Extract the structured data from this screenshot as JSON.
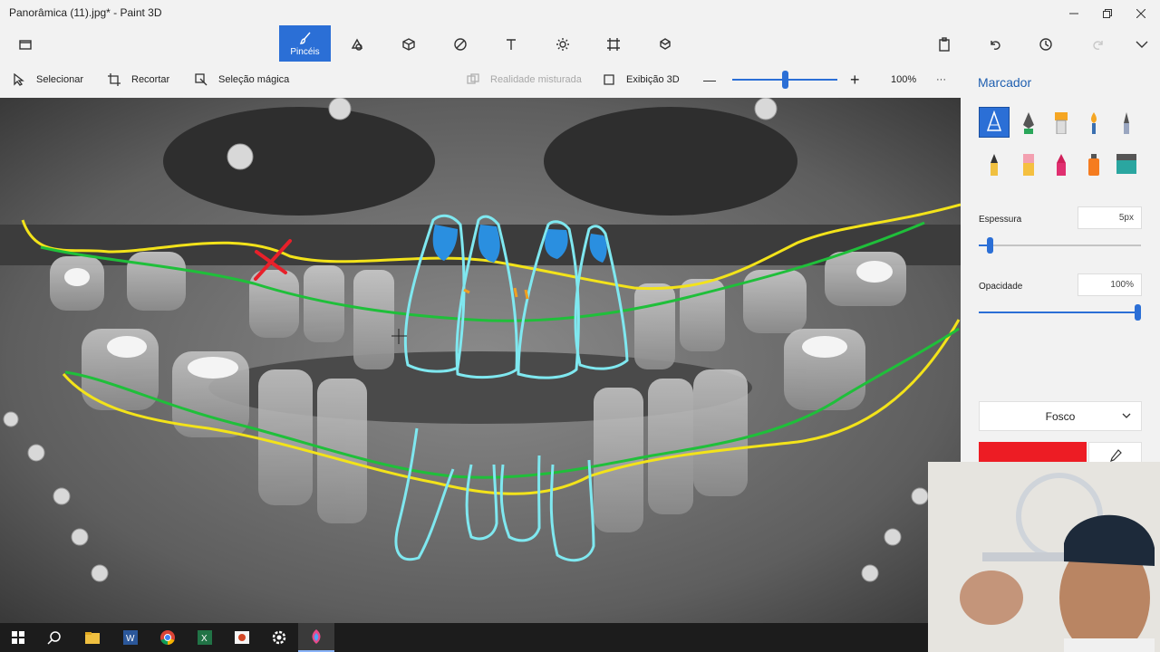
{
  "window": {
    "title": "Panorâmica (11).jpg* - Paint 3D",
    "controls": [
      "minimize",
      "maximize",
      "close"
    ]
  },
  "top_toolbar": {
    "tabs": [
      {
        "name": "menu",
        "icon": "folder-icon"
      },
      {
        "name": "brushes",
        "icon": "brush-icon",
        "label": "Pincéis",
        "active": true
      },
      {
        "name": "2d-shapes",
        "icon": "shapes-2d-icon"
      },
      {
        "name": "3d-shapes",
        "icon": "cube-icon"
      },
      {
        "name": "stickers",
        "icon": "sticker-icon"
      },
      {
        "name": "text",
        "icon": "text-icon"
      },
      {
        "name": "effects",
        "icon": "sun-icon"
      },
      {
        "name": "canvas",
        "icon": "canvas-icon"
      },
      {
        "name": "3d-library",
        "icon": "library-icon"
      }
    ],
    "right_actions": [
      "paste-icon",
      "undo-icon",
      "history-icon",
      "redo-icon",
      "expand-icon"
    ]
  },
  "toolbar": {
    "select_label": "Selecionar",
    "crop_label": "Recortar",
    "magic_select_label": "Seleção mágica",
    "mixed_reality_label": "Realidade misturada",
    "view_3d_label": "Exibição 3D",
    "zoom_minus": "—",
    "zoom_plus": "+",
    "zoom_value": "100%",
    "zoom_level": 0.5,
    "more": "···"
  },
  "panel": {
    "title": "Marcador",
    "brushes": [
      {
        "name": "marker",
        "selected": true
      },
      {
        "name": "calligraphy-pen",
        "selected": false
      },
      {
        "name": "oil-brush",
        "selected": false
      },
      {
        "name": "watercolor",
        "selected": false
      },
      {
        "name": "pixel-pen",
        "selected": false
      },
      {
        "name": "pencil",
        "selected": false
      },
      {
        "name": "eraser",
        "selected": false
      },
      {
        "name": "crayon",
        "selected": false
      },
      {
        "name": "spray-can",
        "selected": false
      },
      {
        "name": "fill",
        "selected": false
      }
    ],
    "thickness_label": "Espessura",
    "thickness_value": "5px",
    "thickness_level": 0.05,
    "opacity_label": "Opacidade",
    "opacity_value": "100%",
    "opacity_level": 1.0,
    "finish_label": "Fosco",
    "color": "#ed1c24"
  },
  "taskbar": {
    "items": [
      "windows-start-icon",
      "search-icon",
      "file-explorer-icon",
      "word-icon",
      "chrome-icon",
      "excel-icon",
      "presentation-icon",
      "settings-icon",
      "paint3d-icon"
    ],
    "active": "paint3d-icon"
  },
  "colors": {
    "accent": "#2b6fd6",
    "annotation_yellow": "#f3e31a",
    "annotation_green": "#1fbf3a",
    "annotation_cyan": "#7fe8f0",
    "annotation_blue": "#2a8fe0",
    "annotation_red": "#e8202a"
  }
}
